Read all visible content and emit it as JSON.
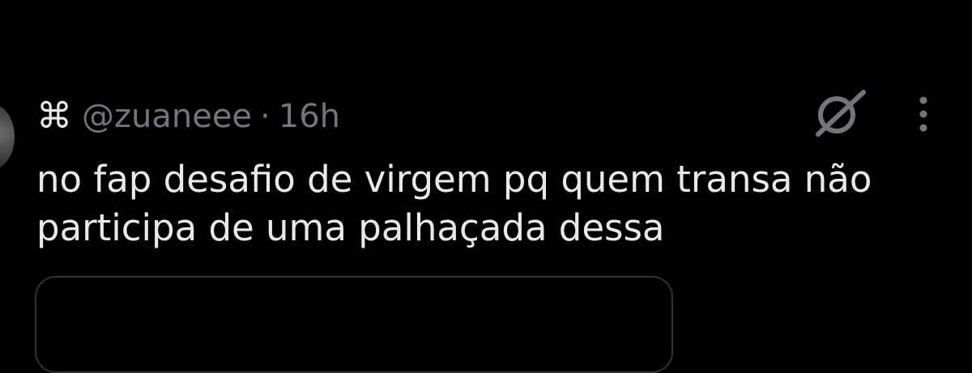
{
  "tweet": {
    "display_name_symbol": "⌘",
    "handle": "@zuaneee",
    "separator": "·",
    "time": "16h",
    "text_line1": "no fap desafio de virgem pq quem transa não",
    "text_line2": "participa de uma palhaçada dessa"
  },
  "icons": {
    "grok": "grok-icon",
    "more": "more-options-icon"
  },
  "colors": {
    "background": "#000000",
    "text_primary": "#e7e9ea",
    "text_secondary": "#71767b",
    "border": "#2f3336"
  }
}
